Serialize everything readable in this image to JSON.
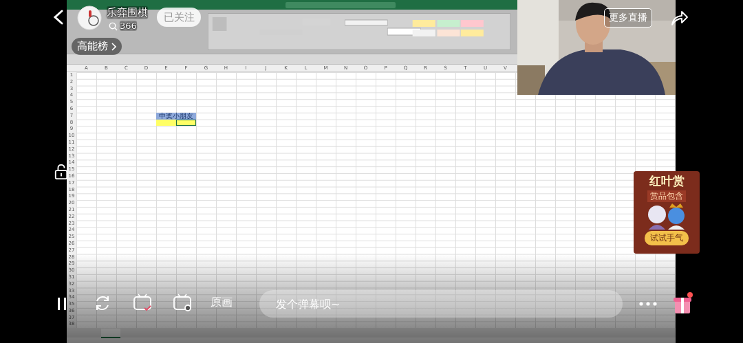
{
  "channel": {
    "name": "乐弈围棋",
    "viewers": "366",
    "follow": "已关注"
  },
  "rank_button": "高能榜",
  "more_live_button": "更多直播",
  "spreadsheet": {
    "columns": [
      "A",
      "B",
      "C",
      "D",
      "E",
      "F",
      "G",
      "H",
      "I",
      "J",
      "K",
      "L",
      "M",
      "N",
      "O",
      "P",
      "Q",
      "R",
      "S",
      "T",
      "U",
      "V"
    ],
    "rows": [
      "1",
      "2",
      "3",
      "4",
      "5",
      "6",
      "7",
      "8",
      "9",
      "10",
      "11",
      "12",
      "13",
      "14",
      "15",
      "16",
      "17",
      "18",
      "19",
      "20",
      "21",
      "22",
      "23",
      "24",
      "25",
      "26",
      "27",
      "28",
      "29",
      "30",
      "31",
      "32",
      "33",
      "34",
      "35",
      "36",
      "37",
      "38"
    ],
    "header_cell": "中奖小朋友"
  },
  "promo": {
    "title": "红叶赏",
    "subtitle": "赏品包含",
    "button": "试试手气"
  },
  "controls": {
    "quality": "原画",
    "comment_placeholder": "发个弹幕呗~"
  }
}
